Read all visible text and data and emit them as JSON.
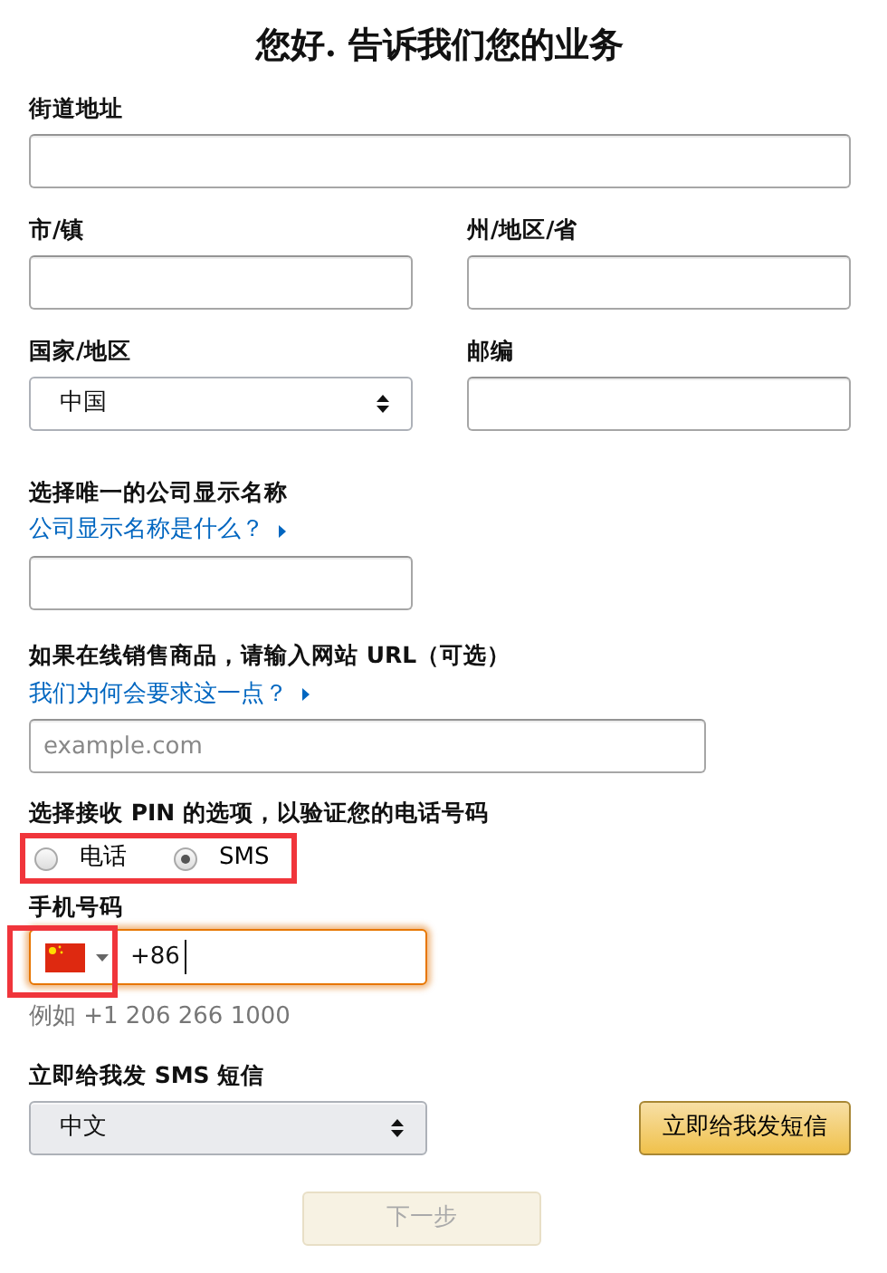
{
  "title": "您好. 告诉我们您的业务",
  "street": {
    "label": "街道地址"
  },
  "city": {
    "label": "市/镇"
  },
  "region": {
    "label": "州/地区/省"
  },
  "country": {
    "label": "国家/地区",
    "value": "中国"
  },
  "postal": {
    "label": "邮编"
  },
  "display_name": {
    "label": "选择唯一的公司显示名称",
    "help_link": "公司显示名称是什么？"
  },
  "website": {
    "label": "如果在线销售商品，请输入网站 URL（可选）",
    "help_link": "我们为何会要求这一点？",
    "placeholder": "example.com"
  },
  "pin": {
    "label": "选择接收 PIN 的选项，以验证您的电话号码",
    "highlighted": true,
    "options": [
      {
        "label": "电话",
        "selected": false
      },
      {
        "label": "SMS",
        "selected": true
      }
    ]
  },
  "phone": {
    "label": "手机号码",
    "value": "+86",
    "focused": true,
    "flag_highlighted": true,
    "hint": "例如 +1 206 266 1000"
  },
  "sms": {
    "label": "立即给我发 SMS 短信",
    "language": "中文",
    "button": "立即给我发短信"
  },
  "next": {
    "label": "下一步",
    "disabled": true
  }
}
